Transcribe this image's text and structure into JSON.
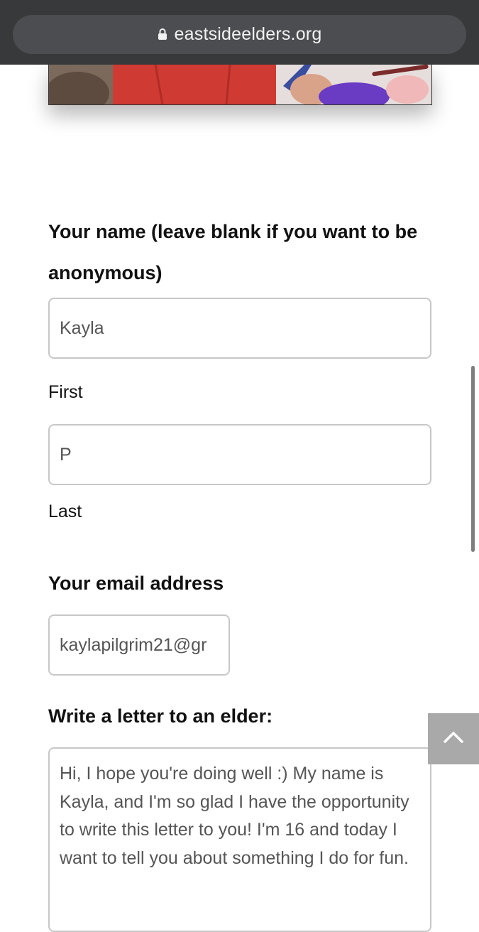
{
  "browser": {
    "url": "eastsideelders.org"
  },
  "form": {
    "name_label": "Your name (leave blank if you want to be anonymous)",
    "first_value": "Kayla",
    "first_sublabel": "First",
    "last_value": "P",
    "last_sublabel": "Last",
    "email_label": "Your email address",
    "email_value": "kaylapilgrim21@gr",
    "letter_label": "Write a letter to an elder:",
    "letter_value": "Hi, I hope you're doing well :) My name is Kayla, and I'm so glad I have the opportunity to write this letter to you! I'm 16 and today I want to tell you about something I do for fun."
  },
  "icons": {
    "lock": "lock-icon",
    "scroll_top": "chevron-up-icon"
  },
  "colors": {
    "toolbar": "#37393b",
    "url_pill": "#4b4d50",
    "hero_red": "#cf3b33",
    "input_border": "#c7c7c7",
    "scroll_top_button": "#a9a9a9"
  }
}
